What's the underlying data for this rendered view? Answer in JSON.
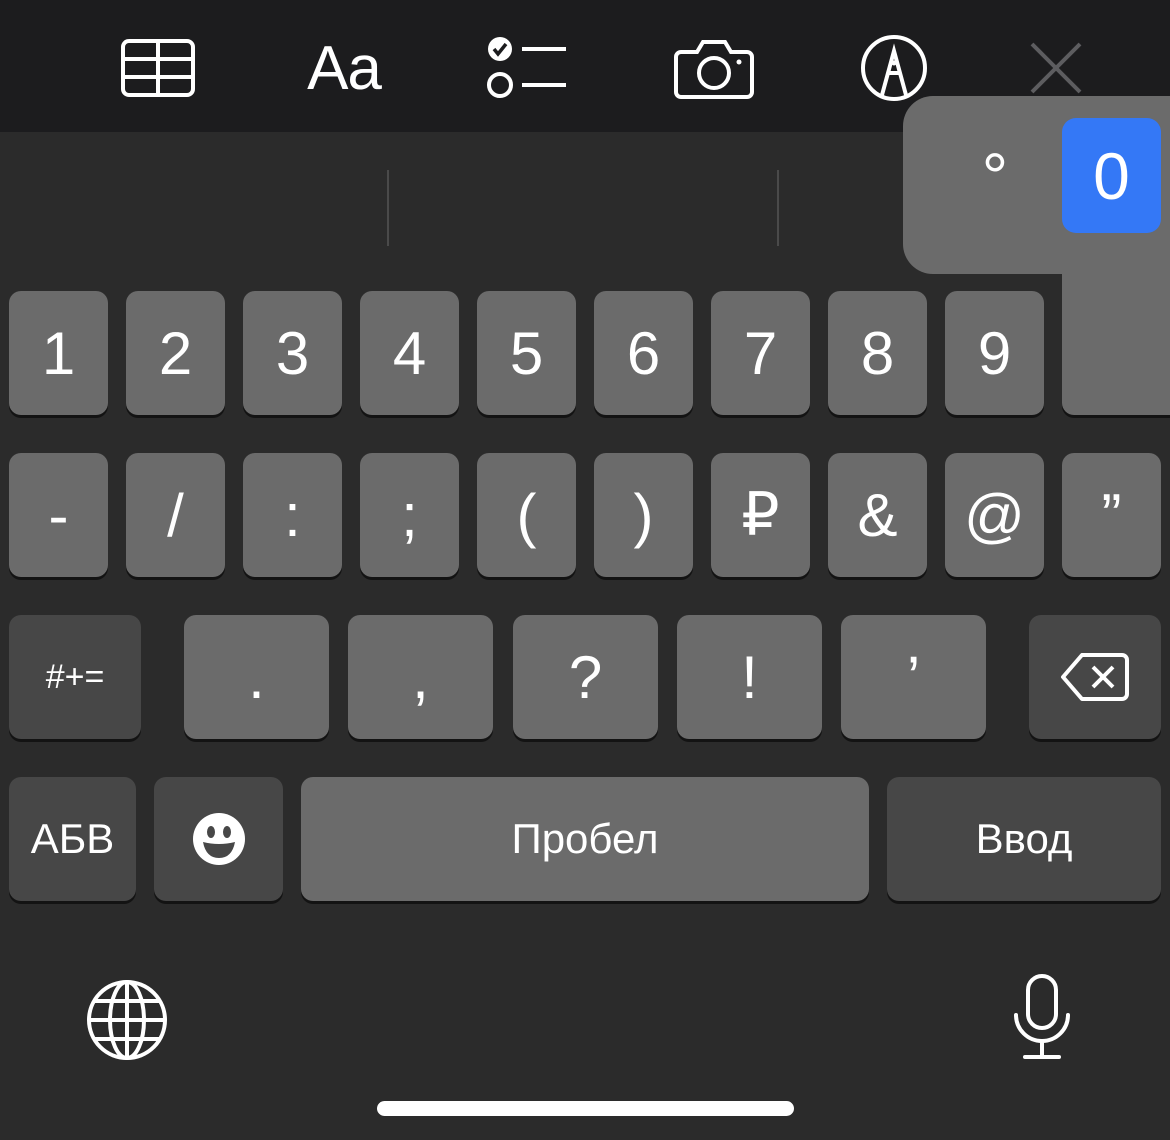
{
  "toolbar": {
    "items": [
      {
        "name": "table",
        "icon": "table-icon"
      },
      {
        "name": "text-format",
        "icon": "text-format-icon",
        "label": "Aa"
      },
      {
        "name": "checklist",
        "icon": "checklist-icon"
      },
      {
        "name": "camera",
        "icon": "camera-icon"
      },
      {
        "name": "markup",
        "icon": "pen-tip-icon"
      },
      {
        "name": "close",
        "icon": "close-icon"
      }
    ]
  },
  "popup": {
    "options": [
      "°",
      "0"
    ],
    "selected": "0",
    "accent": "#3478f6"
  },
  "keyboard": {
    "row1": [
      "1",
      "2",
      "3",
      "4",
      "5",
      "6",
      "7",
      "8",
      "9"
    ],
    "row2": [
      "-",
      "/",
      ":",
      ";",
      "(",
      ")",
      "₽",
      "&",
      "@",
      "”"
    ],
    "row3": {
      "more_symbols": "#+=",
      "keys": [
        ".",
        ",",
        "?",
        "!",
        "’"
      ],
      "backspace_icon": "backspace-icon"
    },
    "row4": {
      "alphabet": "АБВ",
      "emoji_icon": "emoji-icon",
      "space": "Пробел",
      "return": "Ввод"
    },
    "bottom": {
      "globe_icon": "globe-icon",
      "mic_icon": "microphone-icon"
    }
  },
  "colors": {
    "background": "#2b2b2b",
    "toolbar": "#1c1c1e",
    "key": "#6b6b6b",
    "key_dark": "#474747"
  }
}
